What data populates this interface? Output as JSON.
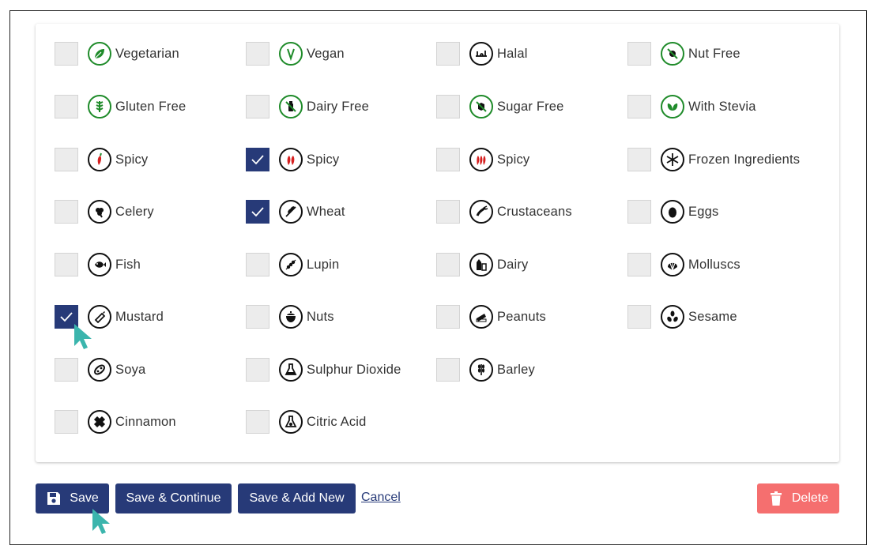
{
  "columns": [
    [
      {
        "label": "Vegetarian",
        "icon": "vegetarian-icon",
        "theme": "green",
        "checked": false
      },
      {
        "label": "Gluten Free",
        "icon": "gluten-free-icon",
        "theme": "green",
        "checked": false
      },
      {
        "label": "Spicy",
        "icon": "chili-mild-icon",
        "theme": "black",
        "checked": false
      },
      {
        "label": "Celery",
        "icon": "celery-icon",
        "theme": "black",
        "checked": false
      },
      {
        "label": "Fish",
        "icon": "fish-icon",
        "theme": "black",
        "checked": false
      },
      {
        "label": "Mustard",
        "icon": "mustard-icon",
        "theme": "black",
        "checked": true
      },
      {
        "label": "Soya",
        "icon": "soya-icon",
        "theme": "black",
        "checked": false
      },
      {
        "label": "Cinnamon",
        "icon": "cinnamon-icon",
        "theme": "black",
        "checked": false
      }
    ],
    [
      {
        "label": "Vegan",
        "icon": "vegan-icon",
        "theme": "green",
        "checked": false
      },
      {
        "label": "Dairy Free",
        "icon": "dairy-free-icon",
        "theme": "green",
        "checked": false
      },
      {
        "label": "Spicy",
        "icon": "chili-medium-icon",
        "theme": "black",
        "checked": true
      },
      {
        "label": "Wheat",
        "icon": "wheat-icon",
        "theme": "black",
        "checked": true
      },
      {
        "label": "Lupin",
        "icon": "lupin-icon",
        "theme": "black",
        "checked": false
      },
      {
        "label": "Nuts",
        "icon": "nuts-icon",
        "theme": "black",
        "checked": false
      },
      {
        "label": "Sulphur Dioxide",
        "icon": "sulphur-dioxide-icon",
        "theme": "black",
        "checked": false
      },
      {
        "label": "Citric Acid",
        "icon": "citric-acid-icon",
        "theme": "black",
        "checked": false
      }
    ],
    [
      {
        "label": "Halal",
        "icon": "halal-icon",
        "theme": "black",
        "checked": false
      },
      {
        "label": "Sugar Free",
        "icon": "sugar-free-icon",
        "theme": "green",
        "checked": false
      },
      {
        "label": "Spicy",
        "icon": "chili-hot-icon",
        "theme": "black",
        "checked": false
      },
      {
        "label": "Crustaceans",
        "icon": "crustaceans-icon",
        "theme": "black",
        "checked": false
      },
      {
        "label": "Dairy",
        "icon": "dairy-icon",
        "theme": "black",
        "checked": false
      },
      {
        "label": "Peanuts",
        "icon": "peanuts-icon",
        "theme": "black",
        "checked": false
      },
      {
        "label": "Barley",
        "icon": "barley-icon",
        "theme": "black",
        "checked": false
      }
    ],
    [
      {
        "label": "Nut Free",
        "icon": "nut-free-icon",
        "theme": "green",
        "checked": false
      },
      {
        "label": "With Stevia",
        "icon": "stevia-icon",
        "theme": "green",
        "checked": false
      },
      {
        "label": "Frozen Ingredients",
        "icon": "snowflake-icon",
        "theme": "black",
        "checked": false
      },
      {
        "label": "Eggs",
        "icon": "egg-icon",
        "theme": "black",
        "checked": false
      },
      {
        "label": "Molluscs",
        "icon": "molluscs-icon",
        "theme": "black",
        "checked": false
      },
      {
        "label": "Sesame",
        "icon": "sesame-icon",
        "theme": "black",
        "checked": false
      }
    ]
  ],
  "actions": {
    "save": "Save",
    "save_continue": "Save & Continue",
    "save_add_new": "Save & Add New",
    "cancel": "Cancel",
    "delete": "Delete"
  },
  "colors": {
    "primary": "#273a78",
    "danger": "#f56f6f",
    "green_icon": "#1f8b2a",
    "cursor": "#3bb5ad"
  }
}
